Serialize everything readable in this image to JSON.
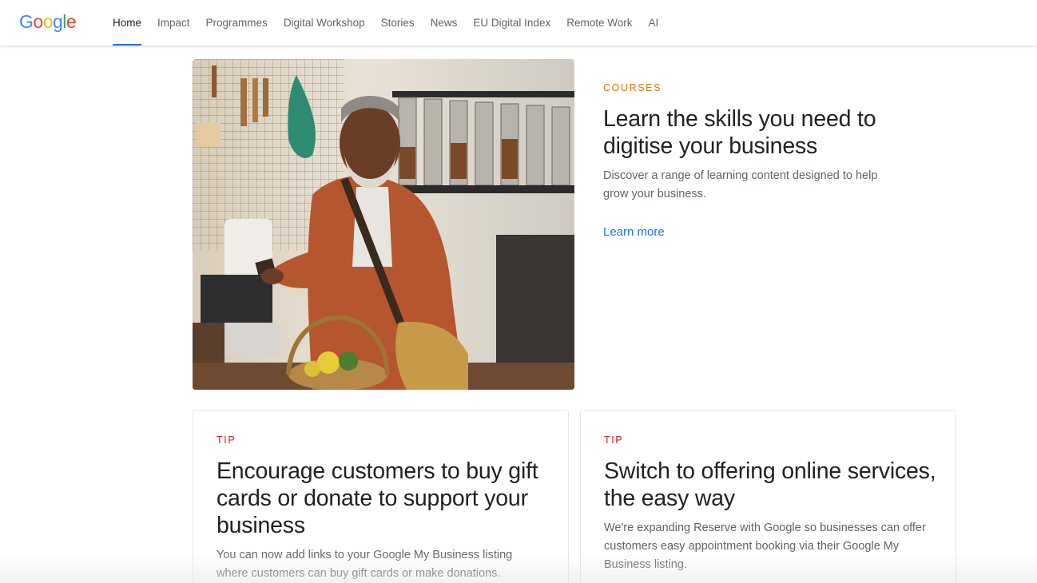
{
  "brand": {
    "logo_letters": [
      {
        "char": "G",
        "color": "#4285F4"
      },
      {
        "char": "o",
        "color": "#EA4335"
      },
      {
        "char": "o",
        "color": "#FBBC05"
      },
      {
        "char": "g",
        "color": "#4285F4"
      },
      {
        "char": "l",
        "color": "#34A853"
      },
      {
        "char": "e",
        "color": "#EA4335"
      }
    ]
  },
  "nav": {
    "items": [
      {
        "label": "Home",
        "active": true
      },
      {
        "label": "Impact"
      },
      {
        "label": "Programmes"
      },
      {
        "label": "Digital Workshop"
      },
      {
        "label": "Stories"
      },
      {
        "label": "News"
      },
      {
        "label": "EU Digital Index"
      },
      {
        "label": "Remote Work"
      },
      {
        "label": "AI"
      }
    ],
    "accent_color": "#1a73e8"
  },
  "feature": {
    "eyebrow": "COURSES",
    "title_line1": "Learn the skills you need to",
    "title_line2": "digitise your business",
    "description_line1": "Discover a range of learning content designed to help",
    "description_line2": "grow your business.",
    "link": "Learn more"
  },
  "cards": [
    {
      "eyebrow": "TIP",
      "title_lines": [
        "Encourage customers to buy gift",
        "cards or donate to support your",
        "business"
      ],
      "description_lines": [
        "You can now add links to your Google My Business listing",
        "where customers can buy gift cards or make donations."
      ]
    },
    {
      "eyebrow": "TIP",
      "title_lines": [
        "Switch to offering online services,",
        "the easy way"
      ],
      "description_lines": [
        "We're expanding Reserve with Google so businesses can offer",
        "customers easy appointment booking via their Google My",
        "Business listing."
      ]
    }
  ],
  "colors": {
    "courses_eyebrow": "#e37400",
    "tip_eyebrow": "#c5221f",
    "link": "#1a73e8"
  }
}
